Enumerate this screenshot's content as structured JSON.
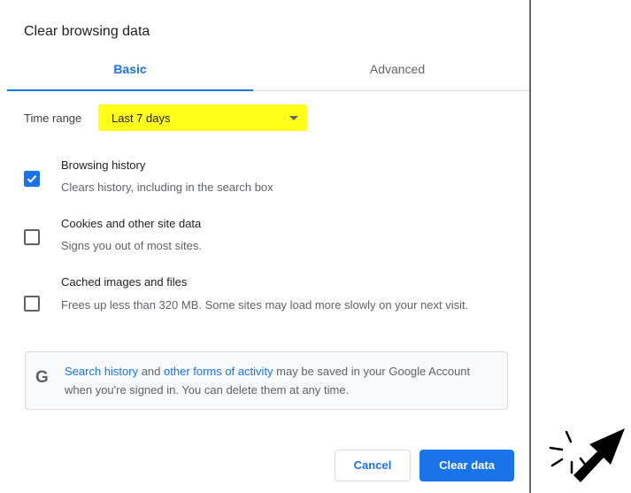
{
  "dialog": {
    "title": "Clear browsing data",
    "tabs": [
      {
        "label": "Basic",
        "selected": true
      },
      {
        "label": "Advanced",
        "selected": false
      }
    ],
    "time_range": {
      "label": "Time range",
      "value": "Last 7 days"
    },
    "options": [
      {
        "title": "Browsing history",
        "description": "Clears history, including in the search box",
        "checked": true
      },
      {
        "title": "Cookies and other site data",
        "description": "Signs you out of most sites.",
        "checked": false
      },
      {
        "title": "Cached images and files",
        "description": "Frees up less than 320 MB. Some sites may load more slowly on your next visit.",
        "checked": false
      }
    ],
    "info": {
      "icon": "G",
      "link1": "Search history",
      "text1": " and ",
      "link2": "other forms of activity",
      "text2": " may be saved in your Google Account when you're signed in. You can delete them at any time."
    },
    "buttons": {
      "cancel": "Cancel",
      "clear": "Clear data"
    }
  },
  "colors": {
    "accent": "#1a73e8",
    "highlight": "#ffff1a"
  }
}
